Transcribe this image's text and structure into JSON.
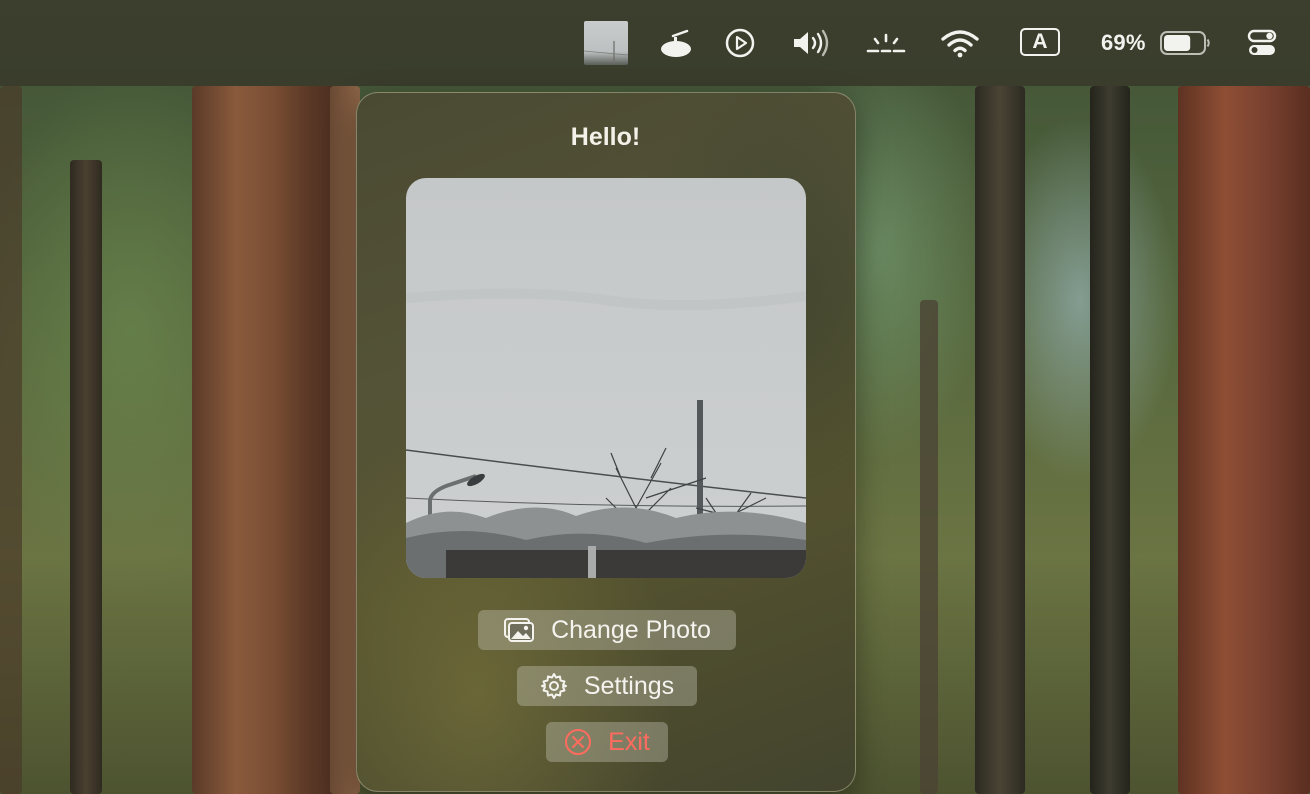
{
  "menubar": {
    "icons": [
      "photo-thumbnail-icon",
      "satellite-dish-icon",
      "play-circle-icon",
      "volume-icon",
      "display-brightness-icon",
      "wifi-icon",
      "input-source-icon",
      "battery-icon",
      "control-center-icon"
    ],
    "input_source_label": "A",
    "battery_percent": "69%",
    "battery_level": 0.69
  },
  "popover": {
    "title": "Hello!",
    "photo_icon": "photo-landscape",
    "buttons": {
      "change_photo": {
        "label": "Change Photo",
        "icon": "photos-icon"
      },
      "settings": {
        "label": "Settings",
        "icon": "gear-icon"
      },
      "exit": {
        "label": "Exit",
        "icon": "close-circle-icon",
        "color": "#ff6b5e"
      }
    }
  },
  "colors": {
    "menubar": "#3a3d2c",
    "popover": "#4e4d33",
    "button_bg": "rgba(200,200,185,0.38)",
    "exit": "#ff6b5e"
  }
}
